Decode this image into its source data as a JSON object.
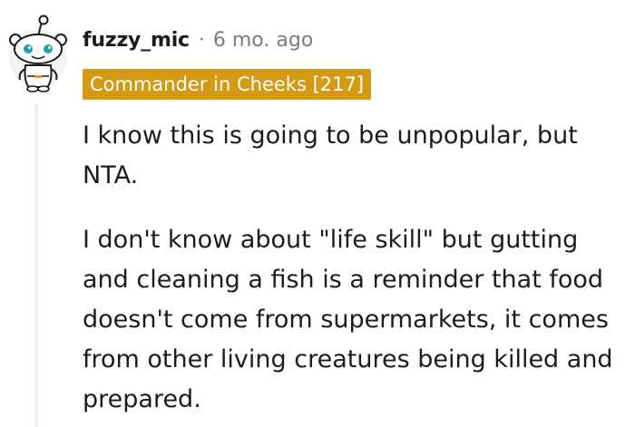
{
  "comment": {
    "author": "fuzzy_mic",
    "separator": "·",
    "timestamp": "6 mo. ago",
    "flair": "Commander in Cheeks [217]",
    "paragraphs": [
      "I know this is going to be unpopular, but NTA.",
      "I don't know about \"life skill\" but gutting and cleaning a fish is a reminder that food doesn't come from supermarkets, it comes from other living creatures being killed and prepared."
    ]
  },
  "avatar": {
    "icon": "snoo-avatar-icon",
    "face_color": "#ffffff",
    "eye_color": "#24a0a8",
    "outline_color": "#1c1c1c"
  },
  "colors": {
    "flair_background": "#d49a13",
    "flair_text": "#ffffff",
    "muted_text": "#7c7c7c",
    "thread_line": "#edeff1"
  }
}
